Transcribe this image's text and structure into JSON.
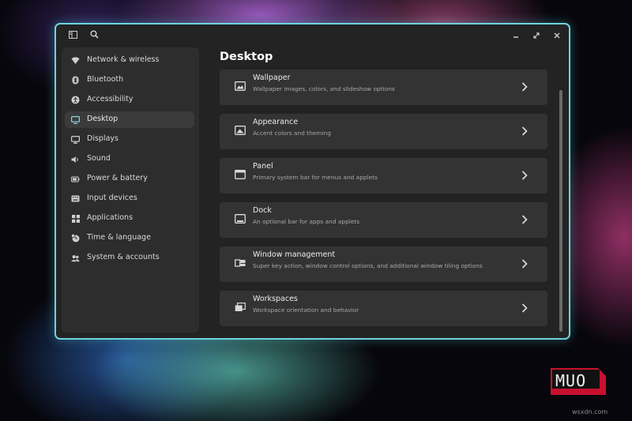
{
  "window": {
    "accent_border": "#6fd3dc",
    "titlebar": {
      "left_icons": [
        "sidebar-toggle-icon",
        "search-icon"
      ],
      "controls": [
        "minimize-icon",
        "maximize-icon",
        "close-icon"
      ]
    }
  },
  "sidebar": {
    "items": [
      {
        "label": "Network & wireless",
        "icon": "wifi-icon"
      },
      {
        "label": "Bluetooth",
        "icon": "bluetooth-icon"
      },
      {
        "label": "Accessibility",
        "icon": "accessibility-icon"
      },
      {
        "label": "Desktop",
        "icon": "desktop-icon",
        "active": true
      },
      {
        "label": "Displays",
        "icon": "display-icon"
      },
      {
        "label": "Sound",
        "icon": "speaker-icon"
      },
      {
        "label": "Power & battery",
        "icon": "battery-icon"
      },
      {
        "label": "Input devices",
        "icon": "keyboard-icon"
      },
      {
        "label": "Applications",
        "icon": "apps-grid-icon"
      },
      {
        "label": "Time & language",
        "icon": "clock-globe-icon"
      },
      {
        "label": "System & accounts",
        "icon": "users-icon"
      }
    ]
  },
  "main": {
    "title": "Desktop",
    "cards": [
      {
        "title": "Wallpaper",
        "desc": "Wallpaper images, colors, and slideshow options",
        "icon": "image-icon"
      },
      {
        "title": "Appearance",
        "desc": "Accent colors and theming",
        "icon": "appearance-icon"
      },
      {
        "title": "Panel",
        "desc": "Primary system bar for menus and applets",
        "icon": "panel-icon"
      },
      {
        "title": "Dock",
        "desc": "An optional bar for apps and applets",
        "icon": "dock-icon"
      },
      {
        "title": "Window management",
        "desc": "Super key action, window control options, and additional window tiling options",
        "icon": "window-management-icon"
      },
      {
        "title": "Workspaces",
        "desc": "Workspace orientation and behavior",
        "icon": "workspaces-icon"
      }
    ]
  },
  "watermark": {
    "brand": "MUO",
    "site": "wsxdn.com"
  }
}
